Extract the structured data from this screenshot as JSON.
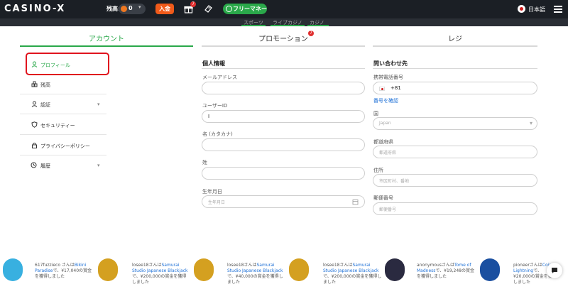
{
  "header": {
    "logo": "CASINO-X",
    "balance_label": "残高:",
    "balance_value": "0",
    "deposit_label": "入金",
    "gift_badge": "7",
    "freemoney_label": "フリーマネー",
    "language": "日本語"
  },
  "subnav": {
    "items": [
      "スポーツ",
      "ライブカジノ",
      "カジノ"
    ]
  },
  "tabs": {
    "account": "アカウント",
    "promotion": "プロモーション",
    "promotion_badge": "7",
    "cashier": "レジ"
  },
  "sidebar": {
    "items": [
      {
        "label": "プロフィール",
        "icon": "user-icon"
      },
      {
        "label": "残高",
        "icon": "balance-icon"
      },
      {
        "label": "認証",
        "icon": "verify-icon"
      },
      {
        "label": "セキュリティー",
        "icon": "shield-icon"
      },
      {
        "label": "プライバシーポリシー",
        "icon": "lock-icon"
      },
      {
        "label": "履歴",
        "icon": "history-icon"
      }
    ]
  },
  "personal": {
    "title": "個人情報",
    "email_label": "メールアドレス",
    "email_value": "",
    "userid_label": "ユーザーID",
    "userid_value": "I",
    "name_label": "名 (カタカナ)",
    "surname_label": "姓",
    "dob_label": "生年月日",
    "dob_placeholder": "生年月日"
  },
  "contact": {
    "title": "問い合わせ先",
    "phone_label": "携帯電話番号",
    "phone_code": "+81",
    "verify_phone": "番号を確認",
    "country_label": "国",
    "country_value": "Japan",
    "prefecture_label": "都道府県",
    "prefecture_placeholder": "都道府県",
    "address_label": "住所",
    "address_placeholder": "市区町村、番地",
    "postal_label": "郵便番号",
    "postal_placeholder": "郵便番号"
  },
  "ticker": [
    {
      "pre": "617fuzzieco さんは",
      "game": "Bikini Paradise",
      "post": "で、¥17,040の賞金を獲得しました"
    },
    {
      "pre": "losee18さんは",
      "game": "Samurai Studio Japanese Blackjack",
      "post": "で、¥200,000の賞金を獲得しました"
    },
    {
      "pre": "losee18さんは",
      "game": "Samurai Studio Japanese Blackjack",
      "post": "で、¥40,000の賞金を獲得しました"
    },
    {
      "pre": "losee18さんは",
      "game": "Samurai Studio Japanese Blackjack",
      "post": "で、¥200,000の賞金を獲得しました"
    },
    {
      "pre": "anonymousさんは",
      "game": "Tome of Madness",
      "post": "で、¥19,248の賞金を獲得しました"
    },
    {
      "pre": "pioneerさんは",
      "game": "Coin Lightning",
      "post": "で、¥20,000の賞金を獲得しました"
    }
  ],
  "colors": {
    "topbar": "#1b1f25",
    "accent_green": "#2aa84a",
    "deposit_orange": "#f05a1a",
    "highlight_red": "#e0141e"
  }
}
